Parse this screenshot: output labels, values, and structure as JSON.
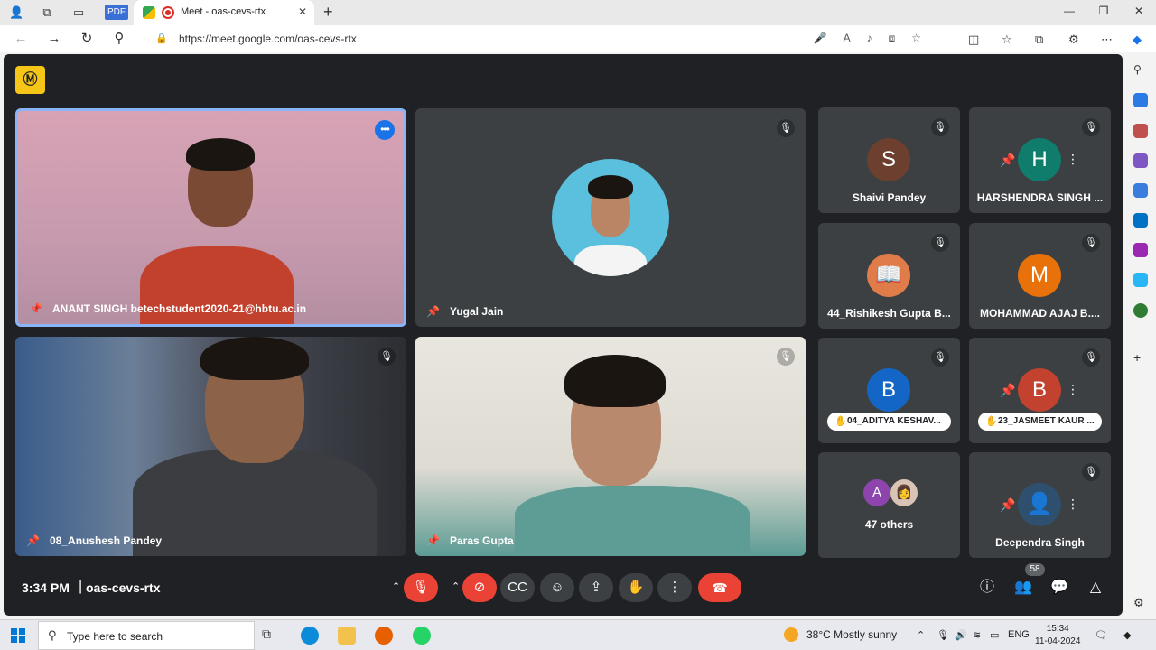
{
  "browser": {
    "pdf_tab_label": "PDF",
    "active_tab_title": "Meet - oas-cevs-rtx",
    "url": "https://meet.google.com/oas-cevs-rtx"
  },
  "meet": {
    "logo_glyph": "Ⓜ",
    "time": "3:34 PM",
    "separator": "|",
    "meeting_code": "oas-cevs-rtx",
    "people_count": "58",
    "main_tiles": [
      {
        "name": "ANANT SINGH betechstudent2020-21@hbtu.ac.in"
      },
      {
        "name": "Yugal Jain"
      },
      {
        "name": "08_Anushesh Pandey"
      },
      {
        "name": "Paras Gupta"
      }
    ],
    "side_tiles": [
      {
        "name": "Shaivi Pandey",
        "initial": "S",
        "color": "#6d3f2f"
      },
      {
        "name": "HARSHENDRA SINGH ...",
        "initial": "H",
        "color": "#0f7c6c"
      },
      {
        "name": "44_Rishikesh Gupta B...",
        "initial": "",
        "color": "#e07b4a"
      },
      {
        "name": "MOHAMMAD AJAJ B....",
        "initial": "M",
        "color": "#e8710a"
      },
      {
        "name": "04_ADITYA KESHAV...",
        "initial": "B",
        "color": "#1366c6"
      },
      {
        "name": "23_JASMEET KAUR ...",
        "initial": "B",
        "color": "#c2412f"
      },
      {
        "name": "47 others",
        "initial": "A",
        "color": "#8e44ad"
      },
      {
        "name": "Deependra Singh",
        "initial": "",
        "color": "#2f4f6f"
      }
    ]
  },
  "taskbar": {
    "search_placeholder": "Type here to search",
    "weather": "38°C  Mostly sunny",
    "lang": "ENG",
    "time": "15:34",
    "date": "11-04-2024"
  },
  "icons": [
    "search-icon",
    "pin-icon",
    "mic-off-icon",
    "camera-off-icon",
    "captions-icon",
    "emoji-icon",
    "present-icon",
    "raise-hand-icon",
    "more-icon",
    "end-call-icon",
    "info-icon",
    "people-icon",
    "chat-icon",
    "activities-icon"
  ]
}
